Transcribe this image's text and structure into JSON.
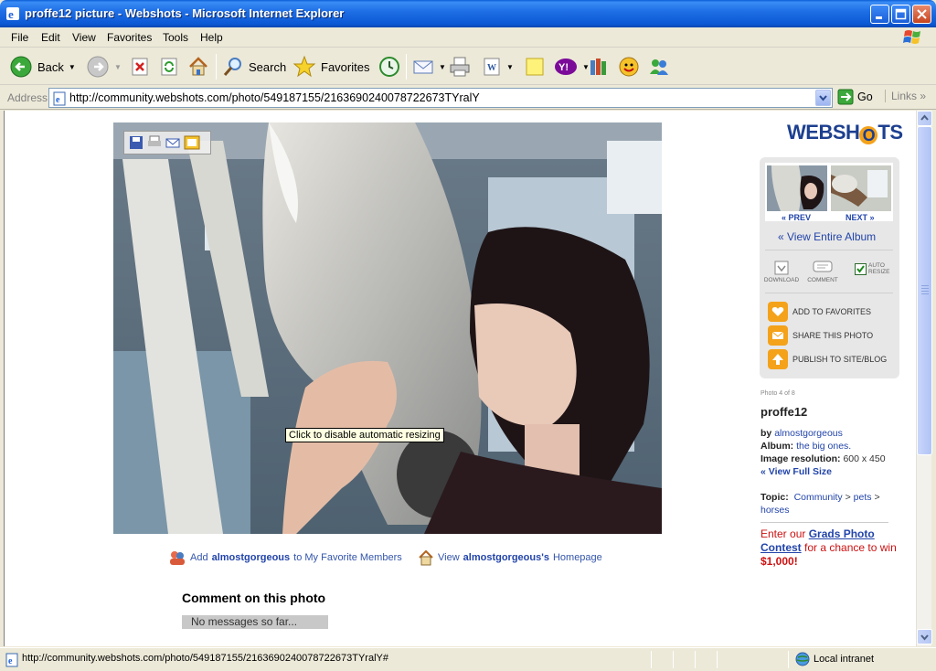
{
  "window": {
    "title": "proffe12 picture - Webshots - Microsoft Internet Explorer"
  },
  "menu": [
    "File",
    "Edit",
    "View",
    "Favorites",
    "Tools",
    "Help"
  ],
  "toolbar": {
    "back_label": "Back",
    "search_label": "Search",
    "favorites_label": "Favorites"
  },
  "address": {
    "label": "Address",
    "url": "http://community.webshots.com/photo/549187155/2163690240078722673TYralY",
    "go_label": "Go",
    "links_label": "Links"
  },
  "photo": {
    "tooltip": "Click to disable automatic resizing"
  },
  "below_photo": {
    "add_prefix": "Add",
    "add_user": "almostgorgeous",
    "add_suffix": "to My Favorite Members",
    "view_prefix": "View",
    "view_user": "almostgorgeous's",
    "view_suffix": "Homepage"
  },
  "comments": {
    "title": "Comment on this photo",
    "empty": "No messages so far..."
  },
  "sidebar": {
    "logo_pre": "WEBSH",
    "logo_o": "O",
    "logo_post": "TS",
    "prev_label": "« PREV",
    "next_label": "NEXT »",
    "view_album": "« View Entire Album",
    "download_label": "DOWNLOAD",
    "comment_label": "COMMENT",
    "auto_resize_line1": "AUTO",
    "auto_resize_line2": "RESIZE",
    "actions": [
      "ADD TO FAVORITES",
      "SHARE THIS PHOTO",
      "PUBLISH TO SITE/BLOG"
    ],
    "photo_count": "Photo 4 of 8",
    "photo_title": "proffe12",
    "by_label": "by",
    "by_user": "almostgorgeous",
    "album_label": "Album:",
    "album_name": "the big ones.",
    "resolution_label": "Image resolution:",
    "resolution_value": "600 x 450",
    "view_full": "« View Full Size",
    "topic_label": "Topic:",
    "topic_1": "Community",
    "topic_2": "pets",
    "topic_3": "horses",
    "topic_sep": ">",
    "contest_1": "Enter our",
    "contest_link": "Grads Photo Contest",
    "contest_2": "for a chance to win",
    "contest_prize": "$1,000!"
  },
  "status": {
    "text": "http://community.webshots.com/photo/549187155/2163690240078722673TYralY#",
    "zone": "Local intranet"
  },
  "colors": {
    "link": "#2244aa",
    "accent_orange": "#f4a21a",
    "contest_red": "#cc1111"
  }
}
